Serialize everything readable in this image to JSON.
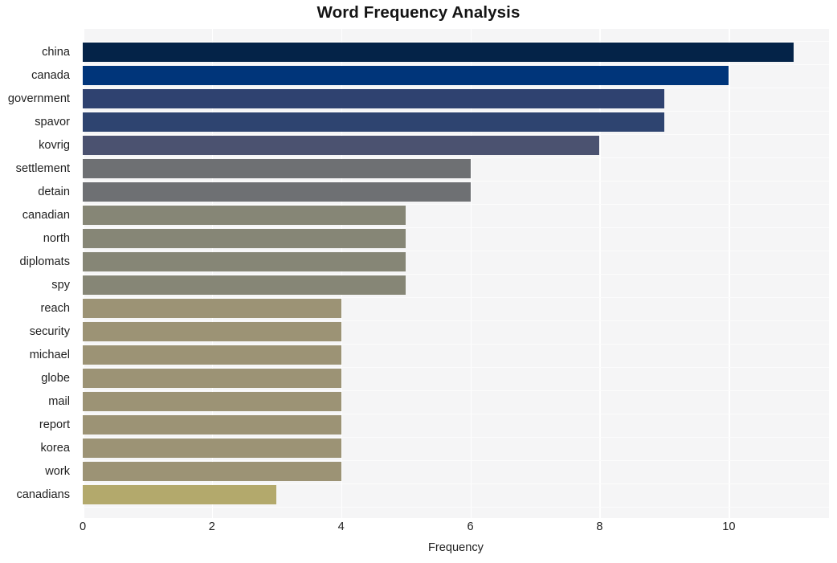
{
  "chart_data": {
    "type": "bar",
    "orientation": "horizontal",
    "title": "Word Frequency Analysis",
    "xlabel": "Frequency",
    "ylabel": "",
    "xlim": [
      0,
      11.55
    ],
    "xticks": [
      0,
      2,
      4,
      6,
      8,
      10
    ],
    "xtick_labels": [
      "0",
      "2",
      "4",
      "6",
      "8",
      "10"
    ],
    "grid": true,
    "grid_axis": "both",
    "legend": "none",
    "categories": [
      "china",
      "canada",
      "government",
      "spavor",
      "kovrig",
      "settlement",
      "detain",
      "canadian",
      "north",
      "diplomats",
      "spy",
      "reach",
      "security",
      "michael",
      "globe",
      "mail",
      "report",
      "korea",
      "work",
      "canadians"
    ],
    "values": [
      11,
      10,
      9,
      9,
      8,
      6,
      6,
      5,
      5,
      5,
      5,
      4,
      4,
      4,
      4,
      4,
      4,
      4,
      4,
      3
    ],
    "bar_colors": [
      "#042348",
      "#00357a",
      "#2f4270",
      "#2e4470",
      "#4b5270",
      "#6e7073",
      "#6e7073",
      "#868676",
      "#868676",
      "#868676",
      "#868676",
      "#9c9375",
      "#9c9375",
      "#9c9375",
      "#9c9375",
      "#9c9375",
      "#9c9375",
      "#9c9375",
      "#9c9375",
      "#b3a96c"
    ],
    "plot_background": "#f5f5f6",
    "gridline_color": "#ffffff",
    "figure_background": "#ffffff"
  }
}
